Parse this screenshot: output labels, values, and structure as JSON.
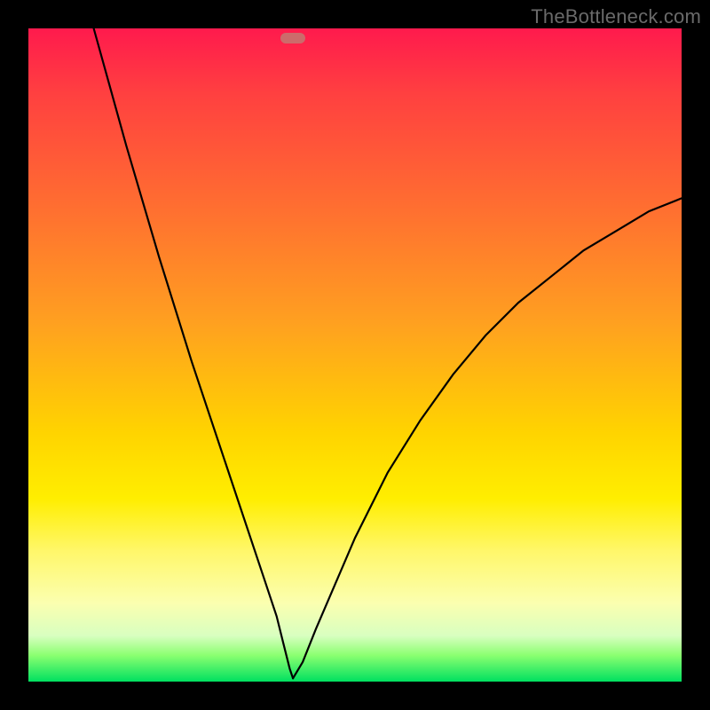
{
  "watermark": "TheBottleneck.com",
  "chart_data": {
    "type": "line",
    "title": "",
    "xlabel": "",
    "ylabel": "",
    "xlim": [
      0,
      100
    ],
    "ylim": [
      0,
      100
    ],
    "grid": false,
    "legend": false,
    "marker": {
      "x": 40.5,
      "y": 98.5,
      "color": "#cc6b6b"
    },
    "series": [
      {
        "name": "left-branch",
        "x": [
          10,
          15,
          20,
          25,
          30,
          33,
          36,
          38,
          39,
          40,
          40.5
        ],
        "y": [
          100,
          82,
          65,
          49,
          34,
          25,
          16,
          10,
          6,
          2,
          0.5
        ]
      },
      {
        "name": "right-branch",
        "x": [
          40.5,
          42,
          44,
          47,
          50,
          55,
          60,
          65,
          70,
          75,
          80,
          85,
          90,
          95,
          100
        ],
        "y": [
          0.5,
          3,
          8,
          15,
          22,
          32,
          40,
          47,
          53,
          58,
          62,
          66,
          69,
          72,
          74
        ]
      }
    ],
    "colors": {
      "curve": "#000000",
      "gradient_top": "#ff1a4d",
      "gradient_bottom": "#00e060",
      "frame": "#000000"
    }
  }
}
